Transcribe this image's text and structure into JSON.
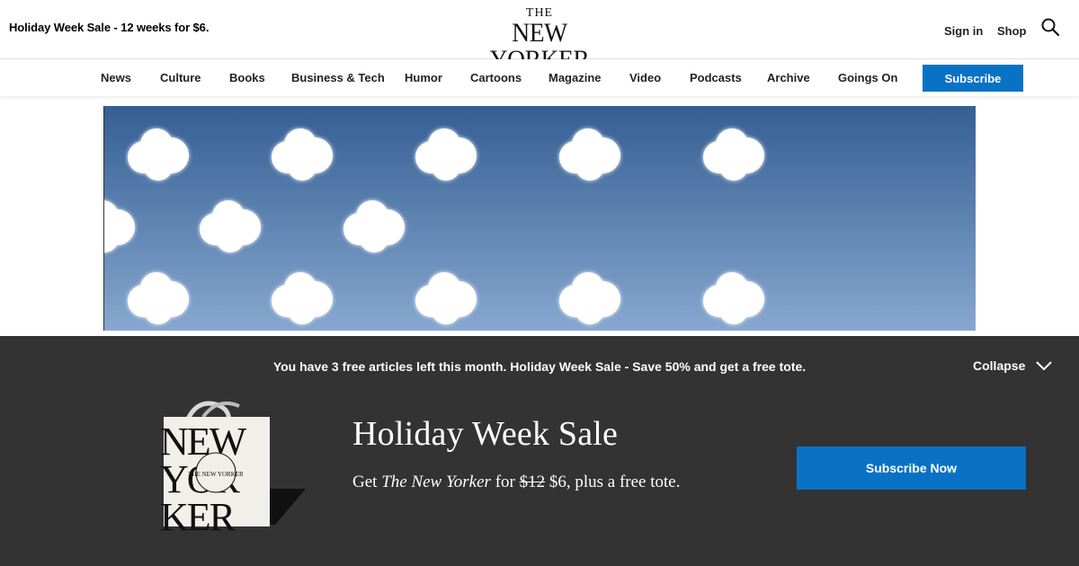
{
  "header": {
    "promo_text": "Holiday Week Sale - 12 weeks for $6.",
    "logo_the": "THE",
    "logo_name": "NEW YORKER",
    "sign_in_label": "Sign in",
    "shop_label": "Shop",
    "search_icon": "search-icon"
  },
  "nav": {
    "items": [
      "News",
      "Culture",
      "Books",
      "Business & Tech",
      "Humor",
      "Cartoons",
      "Magazine",
      "Video",
      "Podcasts",
      "Archive",
      "Goings On"
    ],
    "subscribe_label": "Subscribe"
  },
  "hero": {
    "description_icon": "clouds-illustration",
    "sky_top_color": "#355f93",
    "sky_bottom_color": "#86a7cf"
  },
  "paywall": {
    "message": "You have 3 free articles left this month. Holiday Week Sale - Save 50% and get a free tote.",
    "collapse_label": "Collapse",
    "collapse_icon": "chevron-down-icon",
    "tote_logo_text": "THE NEW YORKER",
    "title": "Holiday Week Sale",
    "sub_get": "Get",
    "sub_magazine": "The New Yorker",
    "sub_for": "for",
    "sub_old_price": "$12",
    "sub_rest": "$6, plus a free tote.",
    "cta_label": "Subscribe Now"
  },
  "colors": {
    "accent": "#0a72c4",
    "paywall_bg": "#333333"
  }
}
